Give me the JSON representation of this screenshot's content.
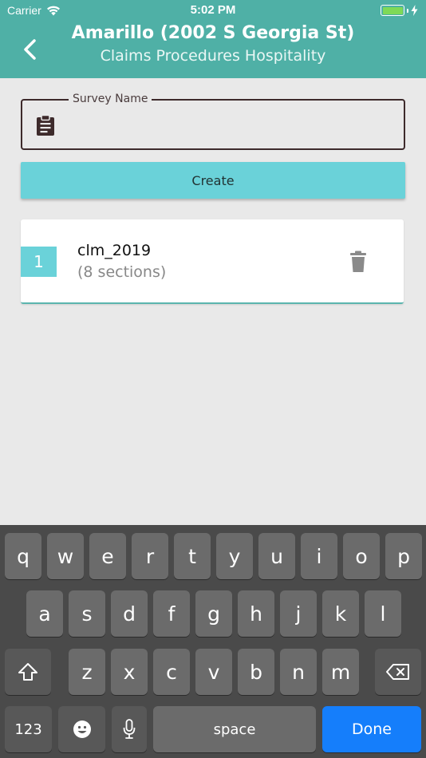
{
  "status_bar": {
    "carrier": "Carrier",
    "time": "5:02 PM"
  },
  "header": {
    "title": "Amarillo (2002 S Georgia St)",
    "subtitle": "Claims Procedures Hospitality"
  },
  "form": {
    "field_label": "Survey Name",
    "field_value": "",
    "create_label": "Create"
  },
  "surveys": [
    {
      "number": "1",
      "name": "clm_2019",
      "sections": "(8 sections)"
    }
  ],
  "keyboard": {
    "row1": [
      "q",
      "w",
      "e",
      "r",
      "t",
      "y",
      "u",
      "i",
      "o",
      "p"
    ],
    "row2": [
      "a",
      "s",
      "d",
      "f",
      "g",
      "h",
      "j",
      "k",
      "l"
    ],
    "row3": [
      "z",
      "x",
      "c",
      "v",
      "b",
      "n",
      "m"
    ],
    "numbers_label": "123",
    "space_label": "space",
    "done_label": "Done"
  },
  "colors": {
    "header": "#4fb0a6",
    "accent": "#6ad2d9",
    "done": "#157efb"
  }
}
